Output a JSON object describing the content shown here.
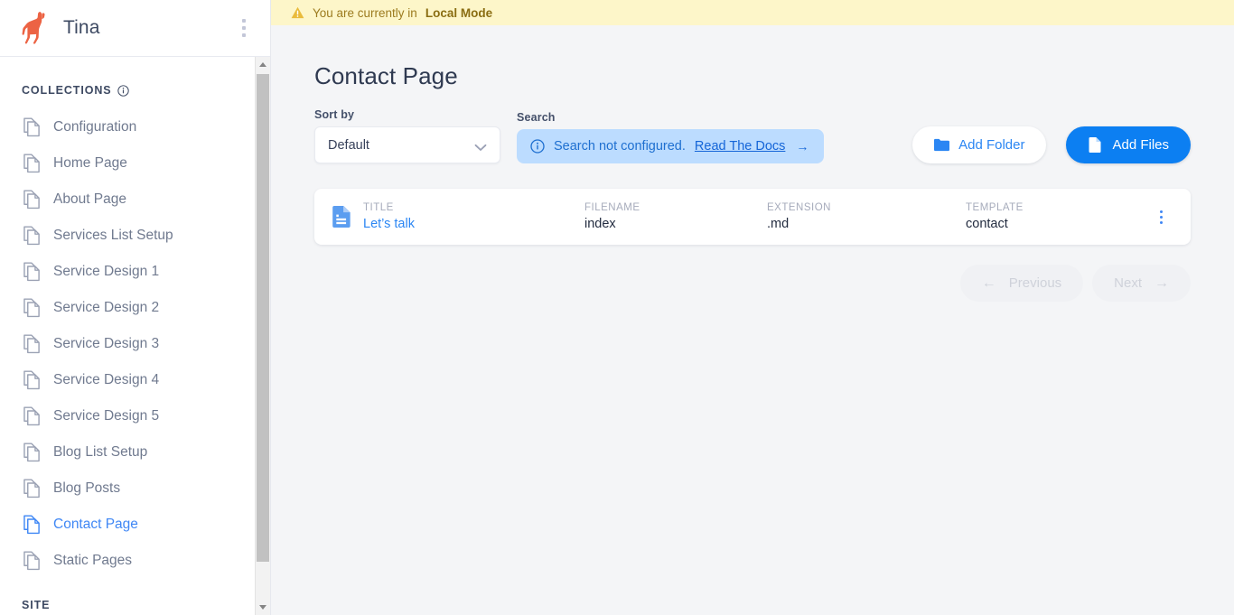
{
  "brand": {
    "title": "Tina",
    "logo_icon": "llama-logo",
    "logo_color": "#ec6344",
    "kebab_icon": "kebab-menu-icon"
  },
  "sidebar": {
    "collections_label": "COLLECTIONS",
    "collections_info_icon": "info-icon",
    "site_label": "SITE",
    "items": [
      {
        "label": "Configuration",
        "icon": "pages-icon",
        "active": false
      },
      {
        "label": "Home Page",
        "icon": "pages-icon",
        "active": false
      },
      {
        "label": "About Page",
        "icon": "pages-icon",
        "active": false
      },
      {
        "label": "Services List Setup",
        "icon": "pages-icon",
        "active": false
      },
      {
        "label": "Service Design 1",
        "icon": "pages-icon",
        "active": false
      },
      {
        "label": "Service Design 2",
        "icon": "pages-icon",
        "active": false
      },
      {
        "label": "Service Design 3",
        "icon": "pages-icon",
        "active": false
      },
      {
        "label": "Service Design 4",
        "icon": "pages-icon",
        "active": false
      },
      {
        "label": "Service Design 5",
        "icon": "pages-icon",
        "active": false
      },
      {
        "label": "Blog List Setup",
        "icon": "pages-icon",
        "active": false
      },
      {
        "label": "Blog Posts",
        "icon": "pages-icon",
        "active": false
      },
      {
        "label": "Contact Page",
        "icon": "pages-icon",
        "active": true
      },
      {
        "label": "Static Pages",
        "icon": "pages-icon",
        "active": false
      }
    ],
    "scrollbar": {
      "up_icon": "scroll-up-arrow",
      "down_icon": "scroll-down-arrow"
    }
  },
  "banner": {
    "icon": "warning-triangle-icon",
    "text": "You are currently in",
    "mode": "Local Mode",
    "background": "#fdf6c9",
    "text_color": "#9c7b1f"
  },
  "main": {
    "title": "Contact Page",
    "sort_by": {
      "label": "Sort by",
      "value": "Default",
      "chevron_icon": "chevron-down-icon"
    },
    "search": {
      "label": "Search",
      "notice": "Search not configured.",
      "link": "Read The Docs",
      "link_arrow": "→",
      "info_icon": "info-circle-icon",
      "background": "#bcdcff"
    },
    "actions": {
      "add_folder": {
        "label": "Add Folder",
        "icon": "folder-icon"
      },
      "add_files": {
        "label": "Add Files",
        "icon": "file-icon",
        "background": "#0c7ff2"
      }
    },
    "table": {
      "row_icon": "document-icon",
      "kebab_icon": "kebab-menu-icon",
      "columns": [
        "TITLE",
        "FILENAME",
        "EXTENSION",
        "TEMPLATE"
      ],
      "rows": [
        {
          "title": "Let’s talk",
          "filename": "index",
          "extension": ".md",
          "template": "contact"
        }
      ]
    },
    "pagination": {
      "previous": "Previous",
      "next": "Next",
      "prev_arrow": "←",
      "next_arrow": "→",
      "disabled": true
    }
  },
  "colors": {
    "accent_blue": "#2b86f3",
    "brand_orange": "#ec6344",
    "page_bg": "#f4f5f7"
  }
}
